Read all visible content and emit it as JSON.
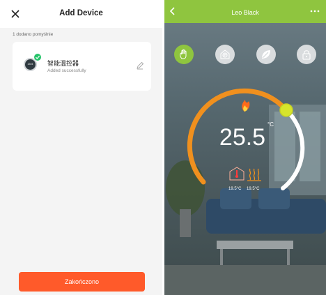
{
  "left": {
    "title": "Add Device",
    "count_text": "1 dodano pomyślnie",
    "device": {
      "name": "智能温控器",
      "status": "Added successfully",
      "display_value": "20.5"
    },
    "finish_label": "Zakończono",
    "accent": "#ff5a2a",
    "success": "#27c46b"
  },
  "right": {
    "title": "Leo Black",
    "set_temperature": "25.5",
    "unit": "°C",
    "reading_1": "19.5°C",
    "reading_2": "19.5°C",
    "modes": [
      "hand-icon",
      "schedule-p-icon",
      "eco-leaf-icon",
      "lock-icon"
    ],
    "active_mode": "hand-icon",
    "header_color": "#8fc53f",
    "dial_color": "#f0901e",
    "dial_level": 0.62
  }
}
